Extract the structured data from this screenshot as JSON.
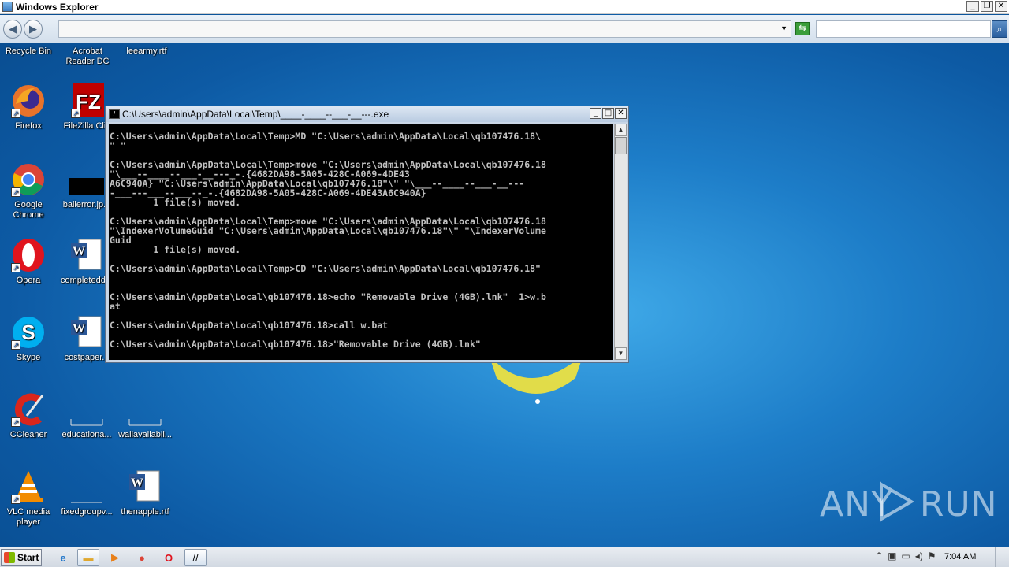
{
  "window": {
    "title": "Windows Explorer",
    "minimize": "_",
    "restore": "❐",
    "close": "✕"
  },
  "nav": {
    "back": "◀",
    "forward": "▶",
    "address_value": "",
    "dropdown": "▼",
    "search_value": ""
  },
  "top_icons": [
    {
      "label": "Recycle Bin"
    },
    {
      "label": "Acrobat Reader DC"
    },
    {
      "label": "leearmy.rtf"
    }
  ],
  "desktop_icons": [
    {
      "label": "Firefox"
    },
    {
      "label": "FileZilla Cli..."
    },
    {
      "label": "Google Chrome"
    },
    {
      "label": "ballerror.jp..."
    },
    {
      "label": "Opera"
    },
    {
      "label": "completedd..."
    },
    {
      "label": "Skype"
    },
    {
      "label": "costpaper..."
    },
    {
      "label": "CCleaner"
    },
    {
      "label": "educationa..."
    },
    {
      "label": "wallavailabil..."
    },
    {
      "label": "VLC media player"
    },
    {
      "label": "fixedgroupv..."
    },
    {
      "label": "thenapple.rtf"
    }
  ],
  "console": {
    "title": "C:\\Users\\admin\\AppData\\Local\\Temp\\____-____--___-__---.exe",
    "lines": [
      "C:\\Users\\admin\\AppData\\Local\\Temp>MD \"C:\\Users\\admin\\AppData\\Local\\qb107476.18\\",
      "\" \"",
      "",
      "C:\\Users\\admin\\AppData\\Local\\Temp>move \"C:\\Users\\admin\\AppData\\Local\\qb107476.18",
      "\"\\___--____--___-__---_-.{4682DA98-5A05-428C-A069-4DE43",
      "A6C940A} \"C:\\Users\\admin\\AppData\\Local\\qb107476.18\"\\\" \"\\___--____--___-__---",
      "-___---___--___--_-.{4682DA98-5A05-428C-A069-4DE43A6C940A}",
      "        1 file(s) moved.",
      "",
      "C:\\Users\\admin\\AppData\\Local\\Temp>move \"C:\\Users\\admin\\AppData\\Local\\qb107476.18",
      "\"\\IndexerVolumeGuid \"C:\\Users\\admin\\AppData\\Local\\qb107476.18\"\\\" \"\\IndexerVolume",
      "Guid",
      "        1 file(s) moved.",
      "",
      "C:\\Users\\admin\\AppData\\Local\\Temp>CD \"C:\\Users\\admin\\AppData\\Local\\qb107476.18\"",
      "",
      "",
      "C:\\Users\\admin\\AppData\\Local\\qb107476.18>echo \"Removable Drive (4GB).lnk\"  1>w.b",
      "at",
      "",
      "C:\\Users\\admin\\AppData\\Local\\qb107476.18>call w.bat",
      "",
      "C:\\Users\\admin\\AppData\\Local\\qb107476.18>\"Removable Drive (4GB).lnk\""
    ]
  },
  "watermark": {
    "left": "ANY",
    "right": "RUN"
  },
  "taskbar": {
    "start_label": "Start",
    "clock": "7:04 AM"
  }
}
